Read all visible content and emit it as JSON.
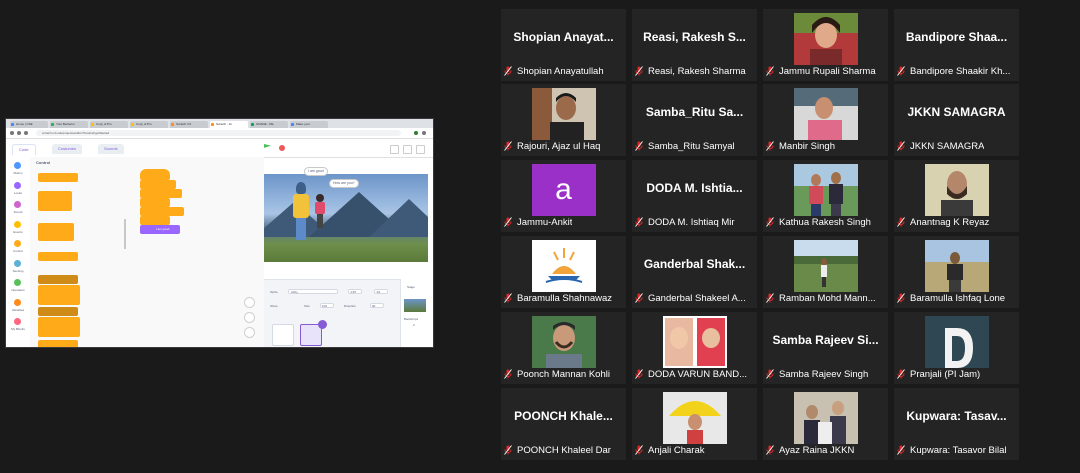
{
  "shared_screen": {
    "browser_tabs": [
      "Home | CSE",
      "Your Behavior",
      "Copy of Pro",
      "Copy of Pro",
      "Scratch 3.0",
      "Scratch - Im",
      "GRADE - RE",
      "Make your"
    ],
    "address": "scratch.mit.edu/projects/editor/?tutorial=getStarted",
    "editor_tabs": [
      "Code",
      "Costumes",
      "Sounds"
    ],
    "categories": [
      {
        "label": "Motion",
        "color": "#4c97ff"
      },
      {
        "label": "Looks",
        "color": "#9966ff"
      },
      {
        "label": "Sound",
        "color": "#cf63cf"
      },
      {
        "label": "Events",
        "color": "#ffbf00"
      },
      {
        "label": "Control",
        "color": "#ffab19"
      },
      {
        "label": "Sensing",
        "color": "#5cb1d6"
      },
      {
        "label": "Operators",
        "color": "#59c059"
      },
      {
        "label": "Variables",
        "color": "#ff8c1a"
      },
      {
        "label": "My Blocks",
        "color": "#ff6680"
      }
    ],
    "palette_title": "Control",
    "speech_1": "I am good",
    "speech_2": "How are you?",
    "script_say": "I am good",
    "sprite_label": "Sprite",
    "sprite_name": "Abby",
    "show_label": "Show",
    "size_label": "Size",
    "size_value": "100",
    "direction_label": "Direction",
    "direction_value": "90",
    "x_value": "-135",
    "y_value": "-51",
    "stage_label": "Stage",
    "backdrops_label": "Backdrops",
    "backdrops_count": "2"
  },
  "participants": [
    {
      "display": "Shopian  Anayat...",
      "label": "Shopian Anayatullah",
      "photo": null
    },
    {
      "display": "Reasi,  Rakesh  S...",
      "label": "Reasi, Rakesh Sharma",
      "photo": null
    },
    {
      "display": "",
      "label": "Jammu Rupali Sharma",
      "photo": "woman-portrait"
    },
    {
      "display": "Bandipore  Shaa...",
      "label": "Bandipore Shaakir Kh...",
      "photo": null
    },
    {
      "display": "",
      "label": "Rajouri, Ajaz ul Haq",
      "photo": "man-portrait-dark"
    },
    {
      "display": "Samba_Ritu  Sa...",
      "label": "Samba_Ritu Samyal",
      "photo": null
    },
    {
      "display": "",
      "label": "Manbir Singh",
      "photo": "man-pink-shirt"
    },
    {
      "display": "JKKN SAMAGRA",
      "label": "JKKN SAMAGRA",
      "photo": null
    },
    {
      "display": "a",
      "label": "Jammu-Ankit",
      "photo": "letter-avatar"
    },
    {
      "display": "DODA  M.  Ishtia...",
      "label": "DODA M. Ishtiaq Mir",
      "photo": null
    },
    {
      "display": "",
      "label": "Kathua Rakesh Singh",
      "photo": "two-people-outdoor"
    },
    {
      "display": "",
      "label": "Anantnag K Reyaz",
      "photo": "man-portrait-beard"
    },
    {
      "display": "",
      "label": "Baramulla Shahnawaz",
      "photo": "samagra-logo"
    },
    {
      "display": "Ganderbal  Shak...",
      "label": "Ganderbal Shakeel A...",
      "photo": null
    },
    {
      "display": "",
      "label": "Ramban Mohd Mann...",
      "photo": "field-person"
    },
    {
      "display": "",
      "label": "Baramulla Ishfaq Lone",
      "photo": "man-outdoor"
    },
    {
      "display": "",
      "label": "Poonch Mannan Kohli",
      "photo": "man-smiling"
    },
    {
      "display": "",
      "label": "DODA VARUN BAND...",
      "photo": "kids-collage"
    },
    {
      "display": "Samba  Rajeev  Si...",
      "label": "Samba Rajeev Singh",
      "photo": null
    },
    {
      "display": "D",
      "label": "Pranjali (PI Jam)",
      "photo": "letter-d"
    },
    {
      "display": "POONCH  Khale...",
      "label": "POONCH Khaleel Dar",
      "photo": null
    },
    {
      "display": "",
      "label": "Anjali Charak",
      "photo": "child-umbrella"
    },
    {
      "display": "",
      "label": "Ayaz Raina JKKN",
      "photo": "group-meeting"
    },
    {
      "display": "Kupwara:  Tasav...",
      "label": "Kupwara: Tasavor Bilal",
      "photo": null
    }
  ],
  "colors": {
    "tile_bg": "#242424",
    "mic_muted": "#e02828",
    "letter_avatar_a": "#9b30c8",
    "letter_avatar_d": "#2f4653"
  }
}
